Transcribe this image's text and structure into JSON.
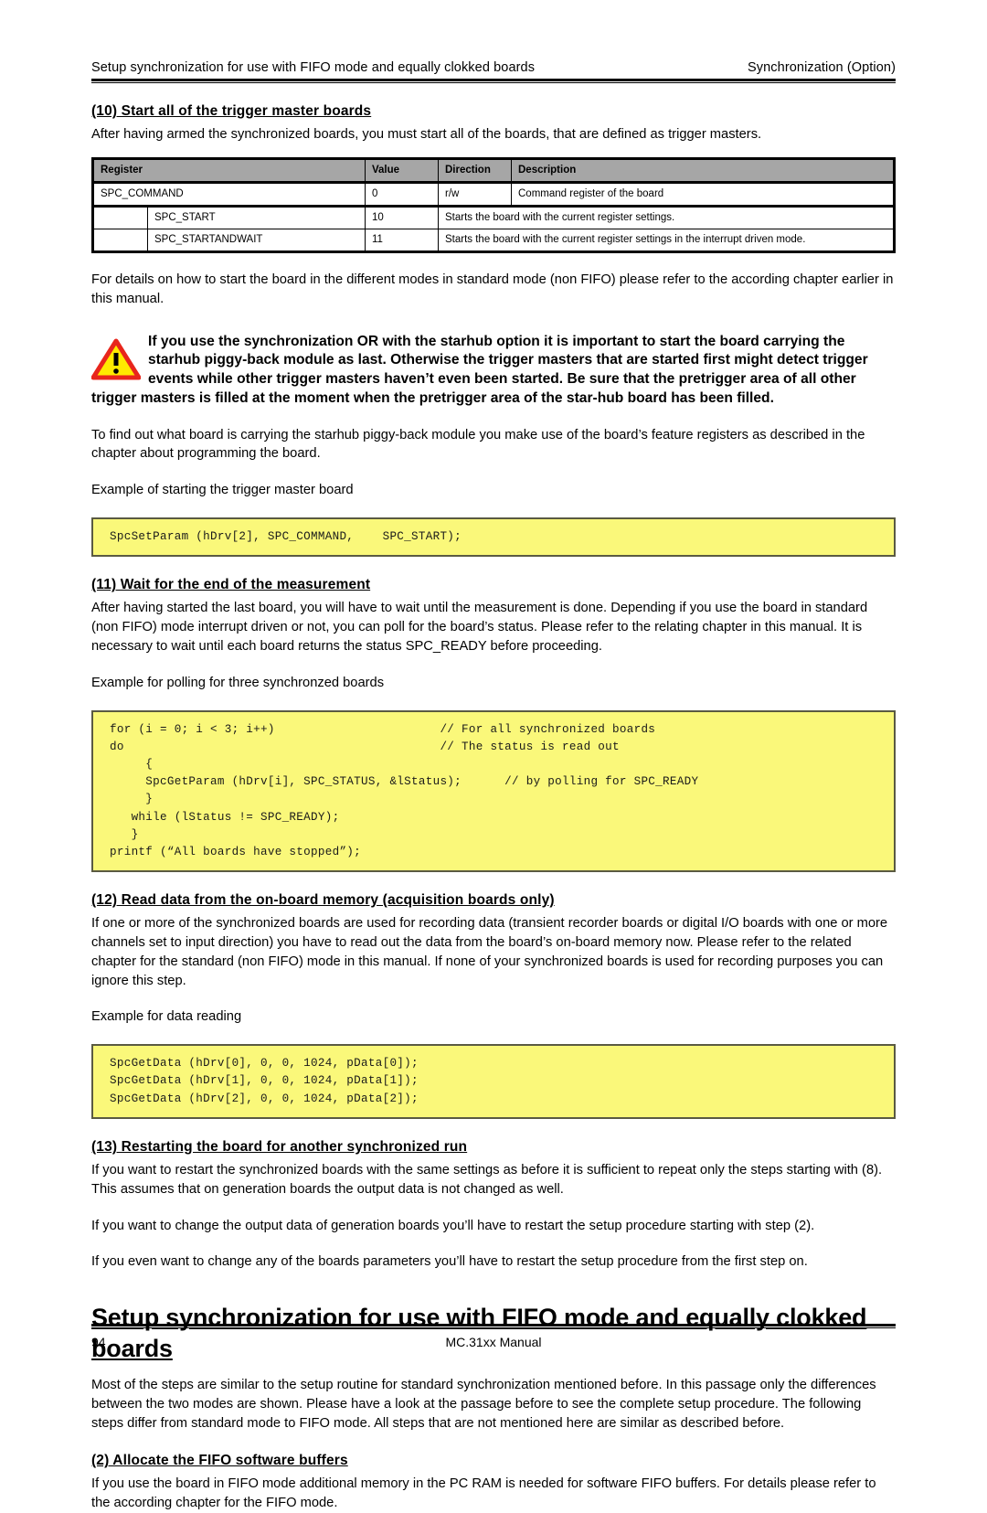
{
  "running_head": {
    "left": "Setup synchronization for use with FIFO mode and equally clokked boards",
    "right": "Synchronization (Option)"
  },
  "step10": {
    "heading": "(10) Start all of the trigger master boards",
    "intro": "After having armed the synchronized boards, you must start all of the boards, that are defined as trigger masters.",
    "after_table": "For details on how to start the board in the different modes in standard mode (non FIFO) please refer to the according chapter earlier in this manual.",
    "starhub_note": "To find out what board is carrying the starhub piggy-back module you make use of the board’s feature registers as described in the chapter about programming the board.",
    "example_caption": "Example of starting the trigger master board",
    "code": "SpcSetParam (hDrv[2], SPC_COMMAND,    SPC_START);"
  },
  "register_table": {
    "headers": [
      "Register",
      "Value",
      "Direction",
      "Description"
    ],
    "main_row": {
      "register": "SPC_COMMAND",
      "value": "0",
      "direction": "r/w",
      "description": "Command register of the board"
    },
    "sub_rows": [
      {
        "register": "SPC_START",
        "value": "10",
        "description": "Starts the board with the current register settings."
      },
      {
        "register": "SPC_STARTANDWAIT",
        "value": "11",
        "description": "Starts the board with the current register settings in the interrupt driven mode."
      }
    ]
  },
  "warning": {
    "icon": "warning-triangle-icon",
    "colors": {
      "fill": "#ffea00",
      "border": "#e8261c",
      "mark": "#000000"
    },
    "text": "If you use the synchronization OR with the starhub option it is important to start the board carrying the starhub piggy-back module as last. Otherwise the trigger masters that are started first might detect trigger events while other trigger masters haven’t even been started. Be sure that the pretrigger area of all other trigger masters is filled at the moment when the pretrigger area of the star-hub board has been filled."
  },
  "step11": {
    "heading": "(11) Wait for the end of the measurement",
    "body": "After having started the last board, you will have to wait until the measurement is done. Depending if you use the board in standard (non FIFO) mode interrupt driven or not, you can poll for the board’s status. Please refer to the relating chapter in this manual. It is necessary to wait until each board returns the status SPC_READY before proceeding.",
    "example_caption": "Example for polling for three synchronzed boards",
    "code": "for (i = 0; i < 3; i++)                       // For all synchronized boards\ndo                                            // The status is read out\n     {\n     SpcGetParam (hDrv[i], SPC_STATUS, &lStatus);      // by polling for SPC_READY\n     }\n   while (lStatus != SPC_READY);\n   }\nprintf (“All boards have stopped”);"
  },
  "step12": {
    "heading": "(12) Read data from the on-board memory (acquisition boards only)",
    "body": "If one or more of the synchronized boards are used for recording data (transient recorder boards or digital I/O boards with one or more channels set to input direction) you have to read out the data from the board’s on-board memory now. Please refer to the related chapter for the standard (non FIFO) mode in this manual. If none of your synchronized boards is used for recording purposes you can ignore this step.",
    "example_caption": "Example for data reading",
    "code": "SpcGetData (hDrv[0], 0, 0, 1024, pData[0]);\nSpcGetData (hDrv[1], 0, 0, 1024, pData[1]);\nSpcGetData (hDrv[2], 0, 0, 1024, pData[2]);"
  },
  "step13": {
    "heading": "(13) Restarting the board for another synchronized run",
    "para1": "If you want to restart the synchronized boards with the same settings as before it is sufficient to repeat only the steps starting with (8). This assumes that on generation boards the output data is not changed as well.",
    "para2": "If you want to change the output data of generation boards you’ll have to restart the setup procedure starting with step (2).",
    "para3": "If you even want to change any of the boards parameters you’ll have to restart the setup procedure from the first step on."
  },
  "chapter": {
    "title": "Setup synchronization for use with FIFO mode and equally clokked boards",
    "intro": "Most of the steps are similar to the setup routine for standard synchronization mentioned before. In this passage only the differences between the two modes are shown. Please have a look at the passage before to see the complete setup procedure. The following steps differ from standard mode to FIFO mode. All steps that are not mentioned here are similar as described before."
  },
  "step2": {
    "heading": "(2) Allocate the FIFO software buffers",
    "body": "If you use the board in FIFO mode additional memory in the PC RAM is needed for software FIFO buffers. For details please refer to the according chapter for the FIFO mode."
  },
  "footer": {
    "page_number": "94",
    "manual_title": "MC.31xx Manual"
  }
}
